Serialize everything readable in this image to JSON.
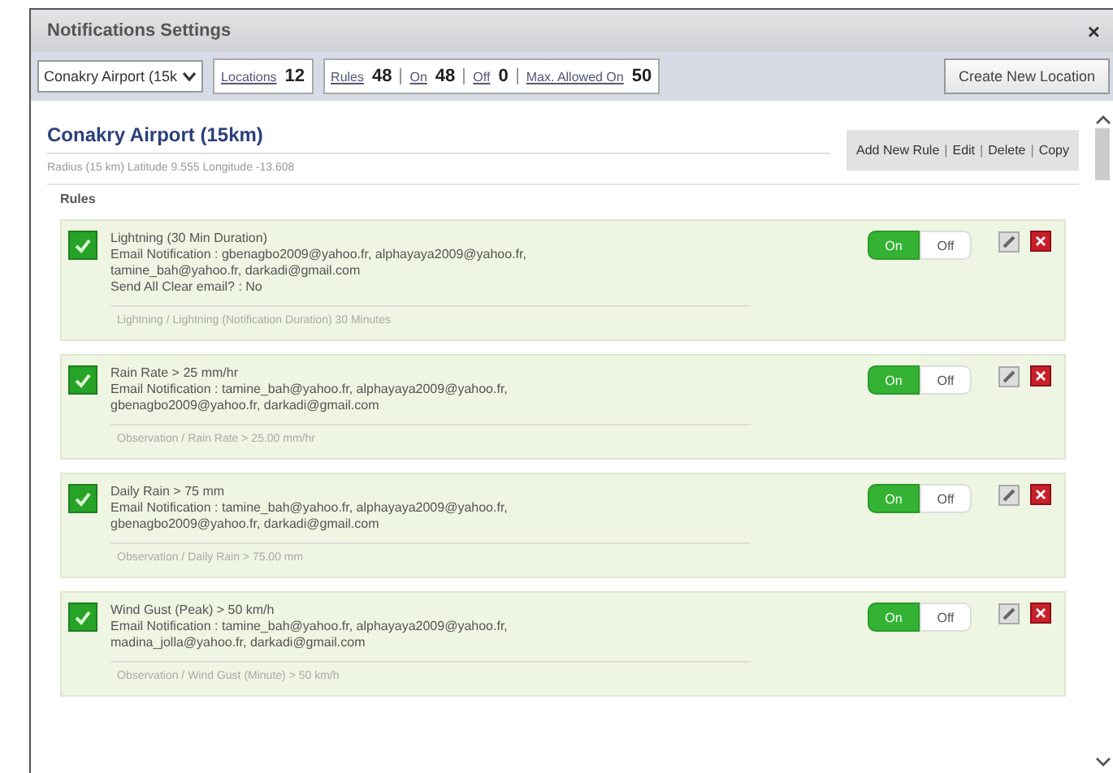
{
  "window": {
    "title": "Notifications Settings",
    "close": "×"
  },
  "toolbar": {
    "location_select": "Conakry Airport (15k",
    "stat_groups": [
      [
        {
          "label": "Locations",
          "value": "12"
        }
      ],
      [
        {
          "label": "Rules",
          "value": "48"
        },
        {
          "label": "On",
          "value": "48"
        },
        {
          "label": "Off",
          "value": "0"
        },
        {
          "label": "Max. Allowed On",
          "value": "50"
        }
      ]
    ],
    "create_button": "Create New Location"
  },
  "location": {
    "title": "Conakry Airport (15km)",
    "subtitle": "Radius (15 km) Latitude 9.555 Longitude -13.608",
    "actions": [
      "Add New Rule",
      "Edit",
      "Delete",
      "Copy"
    ],
    "action_separator": "|"
  },
  "rules_heading": "Rules",
  "rules": [
    {
      "checked": true,
      "on": true,
      "lines": [
        "Lightning (30 Min Duration)",
        "Email Notification : gbenagbo2009@yahoo.fr, alphayaya2009@yahoo.fr,",
        "tamine_bah@yahoo.fr, darkadi@gmail.com",
        "Send All Clear email? : No"
      ],
      "footer": "Lightning / Lightning (Notification Duration) 30 Minutes",
      "on_label": "On",
      "off_label": "Off"
    },
    {
      "checked": true,
      "on": true,
      "lines": [
        "Rain Rate > 25 mm/hr",
        "Email Notification : tamine_bah@yahoo.fr, alphayaya2009@yahoo.fr,",
        "gbenagbo2009@yahoo.fr, darkadi@gmail.com"
      ],
      "footer": "Observation / Rain Rate > 25.00 mm/hr",
      "on_label": "On",
      "off_label": "Off"
    },
    {
      "checked": true,
      "on": true,
      "lines": [
        "Daily Rain > 75 mm",
        "Email Notification : tamine_bah@yahoo.fr, alphayaya2009@yahoo.fr,",
        "gbenagbo2009@yahoo.fr, darkadi@gmail.com"
      ],
      "footer": "Observation / Daily Rain > 75.00 mm",
      "on_label": "On",
      "off_label": "Off"
    },
    {
      "checked": true,
      "on": true,
      "lines": [
        "Wind Gust (Peak) > 50 km/h",
        "Email Notification : tamine_bah@yahoo.fr, alphayaya2009@yahoo.fr,",
        "madina_jolla@yahoo.fr, darkadi@gmail.com"
      ],
      "footer": "Observation / Wind Gust (Minute) > 50 km/h",
      "on_label": "On",
      "off_label": "Off"
    }
  ]
}
